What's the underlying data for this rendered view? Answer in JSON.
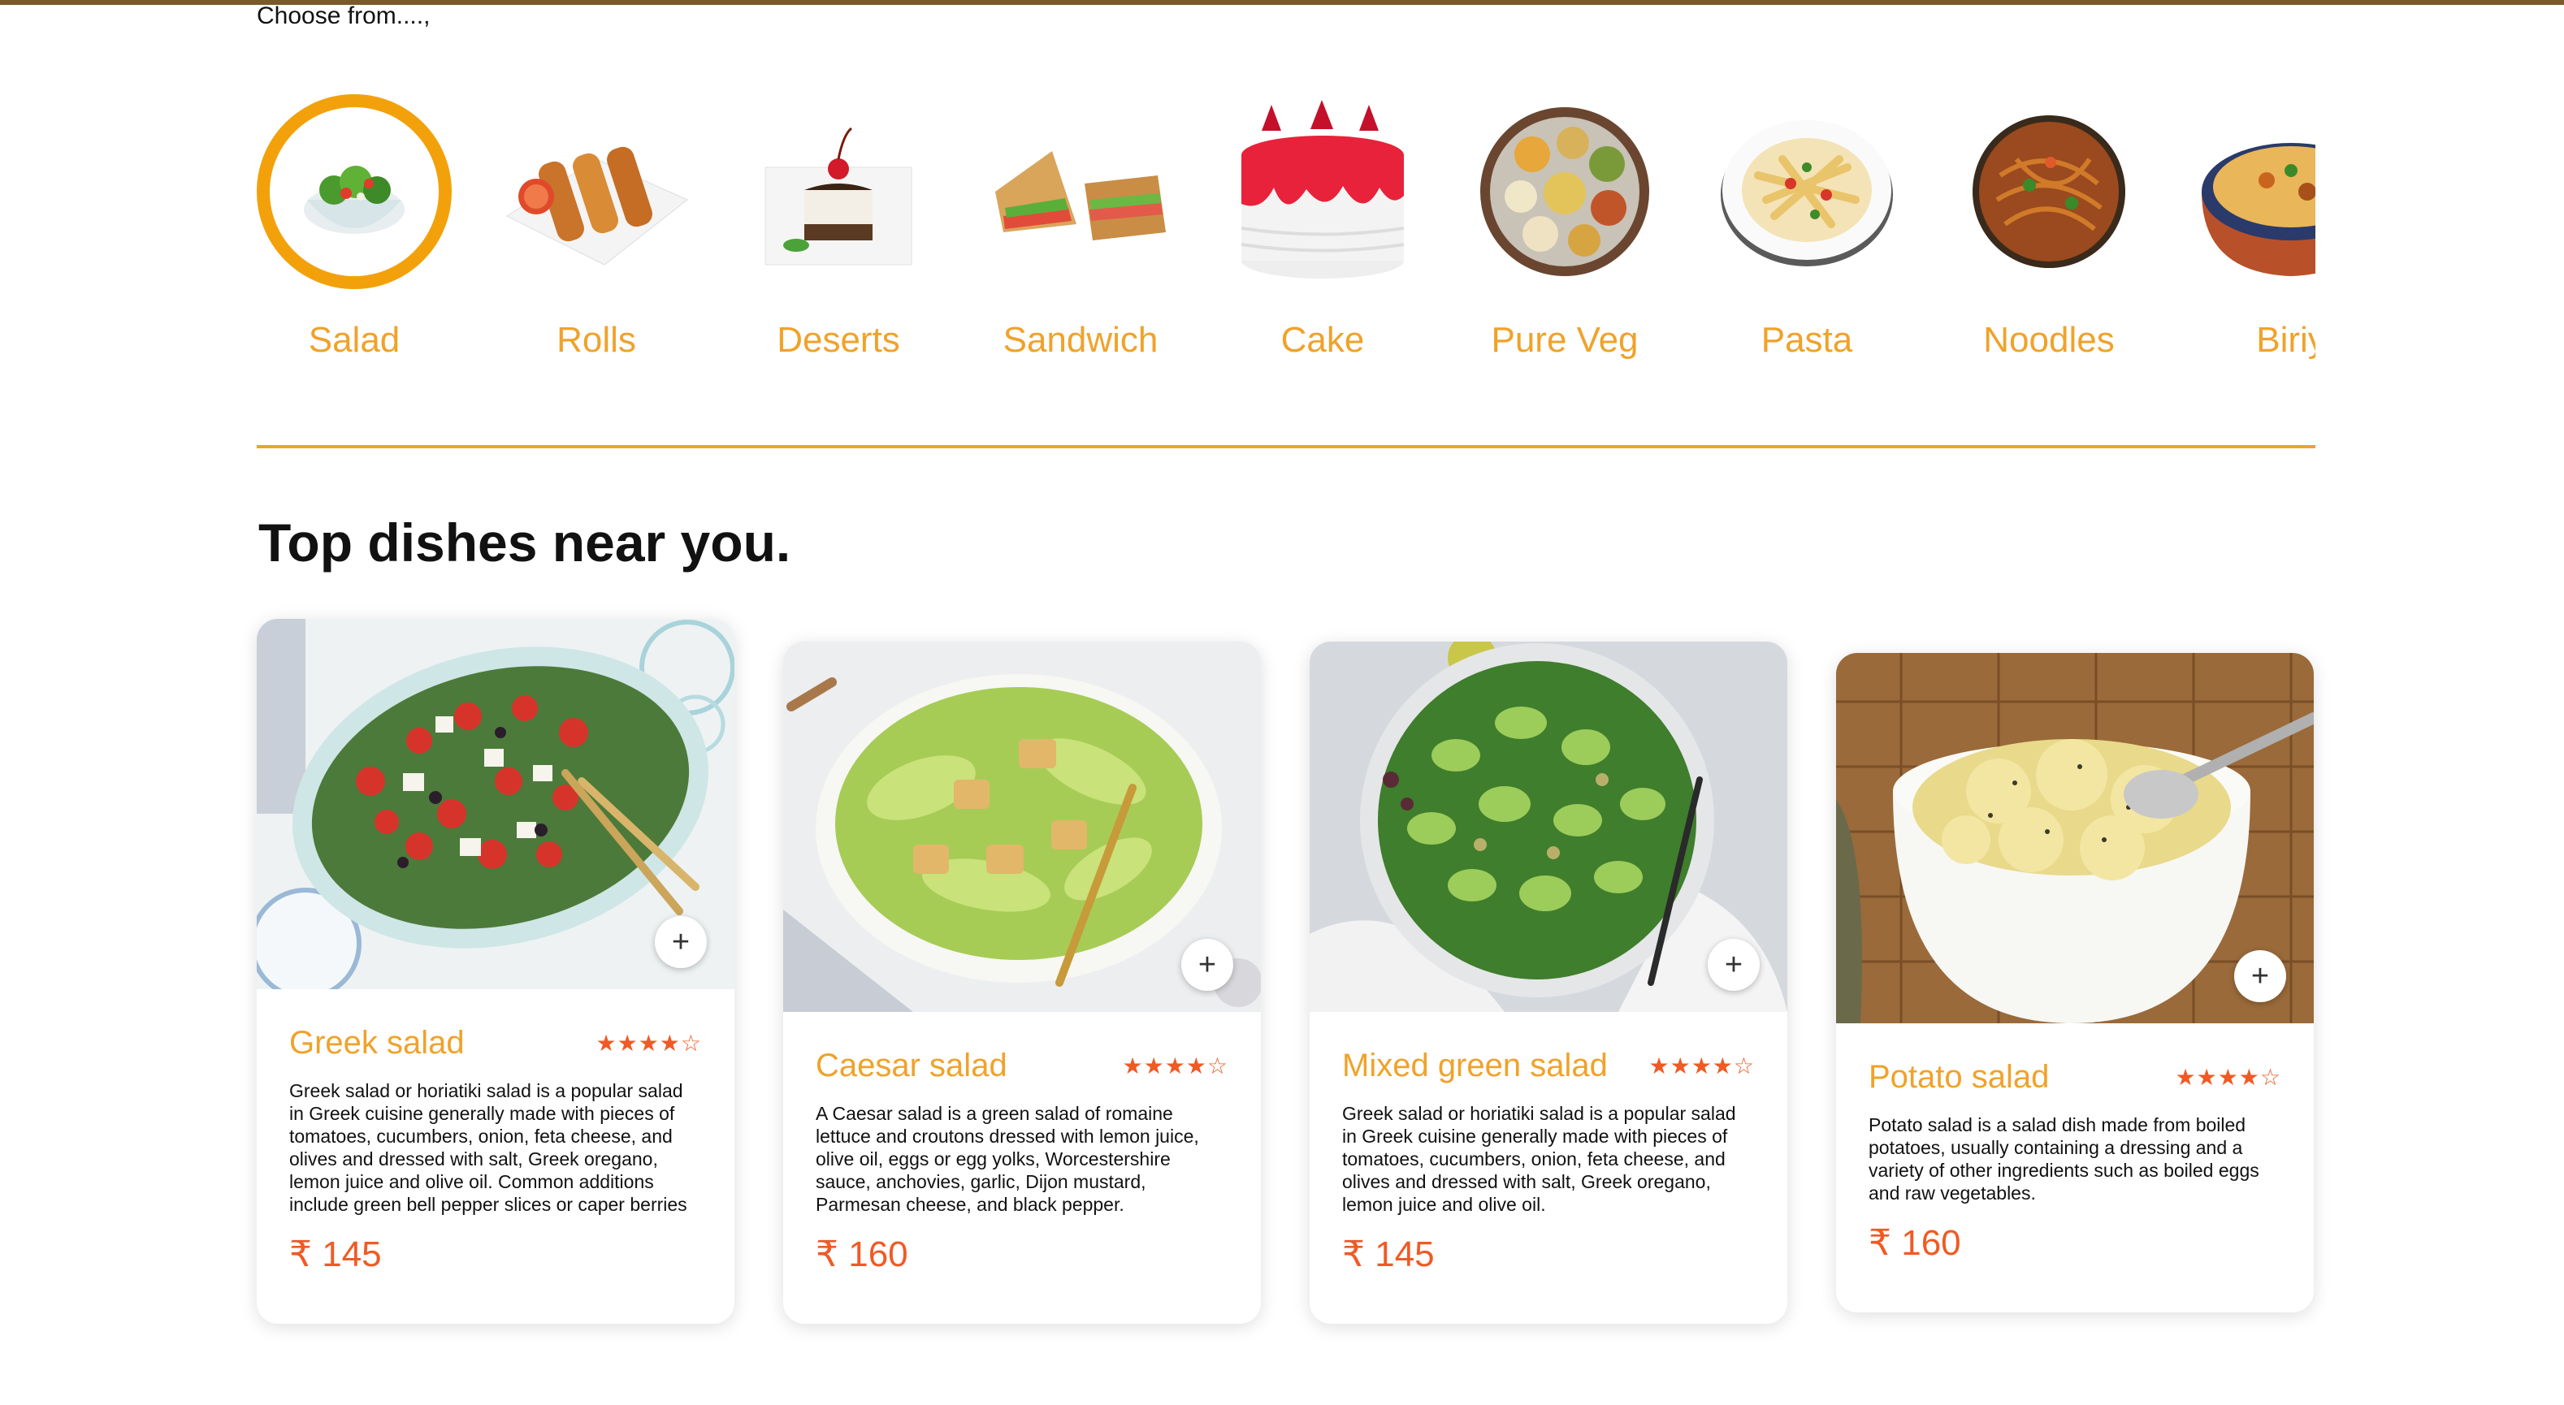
{
  "header": {
    "choose_label": "Choose from....,"
  },
  "categories": [
    {
      "label": "Salad",
      "icon": "salad-bowl-icon",
      "active": true
    },
    {
      "label": "Rolls",
      "icon": "spring-rolls-icon"
    },
    {
      "label": "Deserts",
      "icon": "dessert-cake-icon"
    },
    {
      "label": "Sandwich",
      "icon": "sandwich-icon"
    },
    {
      "label": "Cake",
      "icon": "strawberry-cake-icon"
    },
    {
      "label": "Pure Veg",
      "icon": "veg-thali-icon"
    },
    {
      "label": "Pasta",
      "icon": "pasta-plate-icon"
    },
    {
      "label": "Noodles",
      "icon": "noodles-plate-icon"
    },
    {
      "label": "Biriy",
      "icon": "biryani-pot-icon"
    }
  ],
  "section": {
    "title": "Top dishes near you."
  },
  "dishes": [
    {
      "name": "Greek salad",
      "stars": "★★★★☆",
      "description": "Greek salad or horiatiki salad is a popular salad in Greek cuisine generally made with pieces of tomatoes, cucumbers, onion, feta cheese, and olives and dressed with salt, Greek oregano, lemon juice and olive oil. Common additions include green bell pepper slices or caper berries",
      "price": "₹ 145",
      "add_label": "+"
    },
    {
      "name": "Caesar salad",
      "stars": "★★★★☆",
      "description": "A Caesar salad is a green salad of romaine lettuce and croutons dressed with lemon juice, olive oil, eggs or egg yolks, Worcestershire sauce, anchovies, garlic, Dijon mustard, Parmesan cheese, and black pepper.",
      "price": "₹ 160",
      "add_label": "+"
    },
    {
      "name": "Mixed green salad",
      "stars": "★★★★☆",
      "description": "Greek salad or horiatiki salad is a popular salad in Greek cuisine generally made with pieces of tomatoes, cucumbers, onion, feta cheese, and olives and dressed with salt, Greek oregano, lemon juice and olive oil.",
      "price": "₹ 145",
      "add_label": "+"
    },
    {
      "name": "Potato salad",
      "stars": "★★★★☆",
      "description": "Potato salad is a salad dish made from boiled potatoes, usually containing a dressing and a variety of other ingredients such as boiled eggs and raw vegetables.",
      "price": "₹ 160",
      "add_label": "+"
    }
  ],
  "colors": {
    "accent": "#f0a22a",
    "active_ring": "#f3a10b",
    "price": "#f05a24"
  }
}
